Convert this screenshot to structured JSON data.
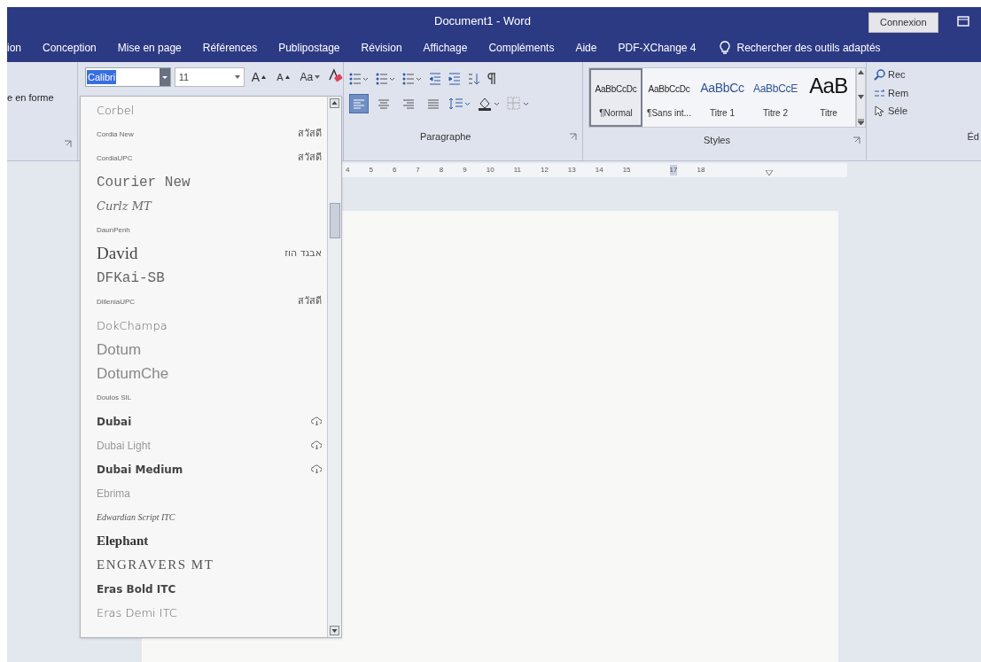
{
  "window": {
    "title": "Document1 - Word",
    "signin_button": "Connexion"
  },
  "tabs": [
    "ion",
    "Conception",
    "Mise en page",
    "Références",
    "Publipostage",
    "Révision",
    "Affichage",
    "Compléments",
    "Aide",
    "PDF-XChange 4"
  ],
  "tell_me": "Rechercher des outils adaptés",
  "ribbon": {
    "left_group_label": "e en forme",
    "font": {
      "font_name": "Calibri",
      "font_size": "11",
      "buttons": [
        {
          "kind": "grow",
          "label": "A"
        },
        {
          "kind": "shrink",
          "label": "A"
        },
        {
          "kind": "case",
          "label": "Aa"
        }
      ]
    },
    "paragraph": {
      "label": "Paragraphe",
      "alignment": [
        {
          "selected": true
        },
        {
          "selected": false
        },
        {
          "selected": false
        },
        {
          "selected": false
        }
      ]
    },
    "styles": {
      "label": "Styles",
      "items": [
        {
          "preview": "AaBbCcDc",
          "name": "¶Normal",
          "kind": "body",
          "selected": true
        },
        {
          "preview": "AaBbCcDc",
          "name": "¶Sans int...",
          "kind": "body",
          "selected": false
        },
        {
          "preview": "AaBbCc",
          "name": "Titre 1",
          "kind": "heading1",
          "selected": false
        },
        {
          "preview": "AaBbCcE",
          "name": "Titre 2",
          "kind": "heading2",
          "selected": false
        },
        {
          "preview": "AaB",
          "name": "Titre",
          "kind": "title",
          "selected": false
        }
      ]
    },
    "editing": {
      "items": [
        {
          "kind": "find",
          "label": "Rec"
        },
        {
          "kind": "replace",
          "label": "Rem"
        },
        {
          "kind": "select",
          "label": "Séle"
        }
      ],
      "label": "Éd"
    }
  },
  "ruler": [
    "4",
    "5",
    "6",
    "7",
    "8",
    "9",
    "10",
    "11",
    "12",
    "13",
    "14",
    "15",
    "17",
    "18"
  ],
  "font_list": [
    {
      "name": "Corbel",
      "kind": "sans"
    },
    {
      "name": "Cordia New",
      "kind": "small",
      "sample": "สวัสดี"
    },
    {
      "name": "CordiaUPC",
      "kind": "small",
      "sample": "สวัสดี"
    },
    {
      "name": "Courier New",
      "kind": "mono"
    },
    {
      "name": "Curlz MT",
      "kind": "serif"
    },
    {
      "name": "DaunPenh",
      "kind": "small"
    },
    {
      "name": "David",
      "kind": "serif_large",
      "sample": "אבגד הוז"
    },
    {
      "name": "DFKai-SB",
      "kind": "mono"
    },
    {
      "name": "DilleniaUPC",
      "kind": "small",
      "sample": "สวัสดี"
    },
    {
      "name": "DokChampa",
      "kind": "sans"
    },
    {
      "name": "Dotum",
      "kind": "sans_large"
    },
    {
      "name": "DotumChe",
      "kind": "sans_large"
    },
    {
      "name": "Doulos SIL",
      "kind": "small"
    },
    {
      "name": "Dubai",
      "kind": "sans_bold",
      "cloud": true
    },
    {
      "name": "Dubai Light",
      "kind": "sans_light",
      "cloud": true
    },
    {
      "name": "Dubai Medium",
      "kind": "sans_bold",
      "cloud": true
    },
    {
      "name": "Ebrima",
      "kind": "sans_light"
    },
    {
      "name": "Edwardian Script ITC",
      "kind": "script"
    },
    {
      "name": "Elephant",
      "kind": "serif_bold"
    },
    {
      "name": "ENGRAVERS MT",
      "kind": "serif_wide"
    },
    {
      "name": "Eras Bold ITC",
      "kind": "sans_bold"
    },
    {
      "name": "Eras Demi ITC",
      "kind": "sans"
    }
  ]
}
